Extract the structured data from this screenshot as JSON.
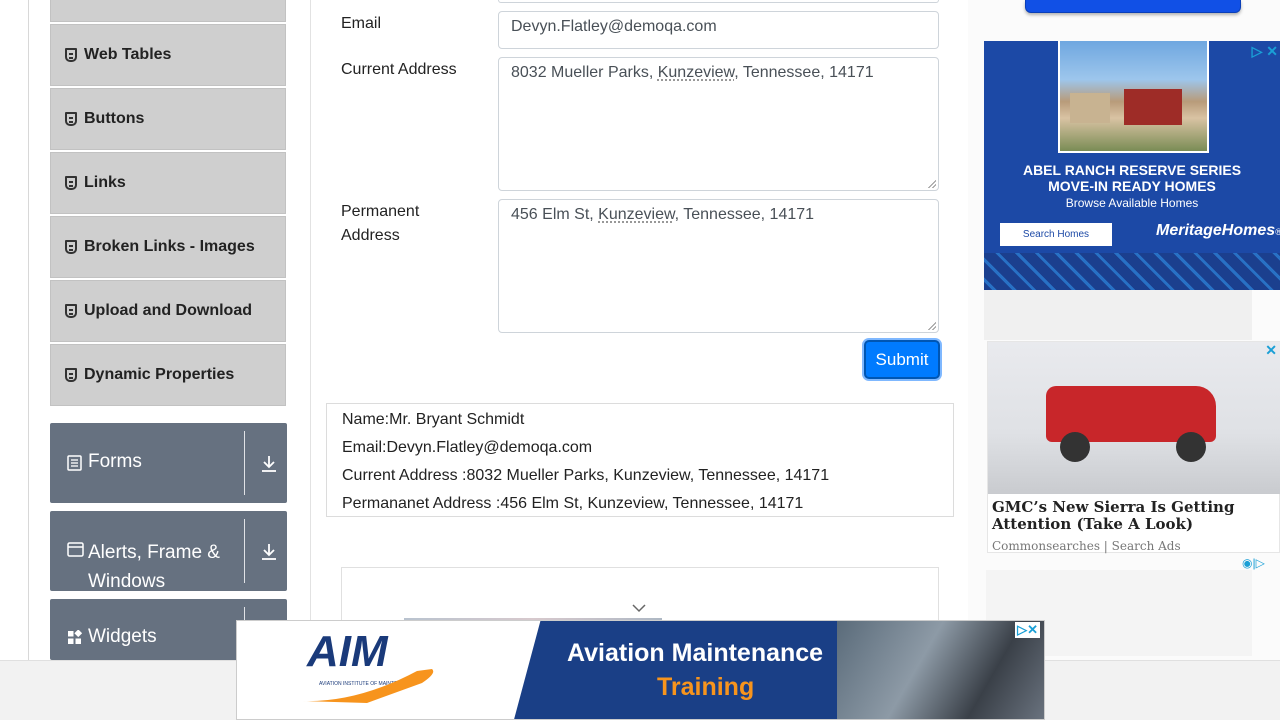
{
  "sidebar": {
    "elements_items": [
      {
        "label": "Web Tables"
      },
      {
        "label": "Buttons"
      },
      {
        "label": "Links"
      },
      {
        "label": "Broken Links - Images"
      },
      {
        "label": "Upload and Download"
      },
      {
        "label": "Dynamic Properties"
      }
    ],
    "groups": [
      {
        "label": "Forms"
      },
      {
        "label": "Alerts, Frame & Windows"
      },
      {
        "label": "Widgets"
      }
    ]
  },
  "form": {
    "email_label": "Email",
    "email_value": "Devyn.Flatley@demoqa.com",
    "current_address_label": "Current Address",
    "current_address": {
      "part1": "8032 Mueller Parks, ",
      "city": "Kunzeview",
      "part2": ", Tennessee, 14171"
    },
    "permanent_address_label_line1": "Permanent",
    "permanent_address_label_line2": "Address",
    "permanent_address": {
      "part1": "456 Elm St, ",
      "city": "Kunzeview",
      "part2": ", Tennessee, 14171"
    },
    "submit_label": "Submit"
  },
  "output": {
    "name": "Name:Mr. Bryant Schmidt",
    "email": "Email:Devyn.Flatley@demoqa.com",
    "current_address": "Current Address :8032 Mueller Parks, Kunzeview, Tennessee, 14171",
    "permanent_address": "Permananet Address :456 Elm St, Kunzeview, Tennessee, 14171"
  },
  "ads": {
    "home_ad": {
      "headline_line1": "ABEL RANCH RESERVE SERIES",
      "headline_line2": "MOVE-IN READY HOMES",
      "subline": "Browse Available Homes",
      "button": "Search Homes",
      "brand": "MeritageHomes",
      "brand_suffix": "®"
    },
    "truck_ad": {
      "title_line1": "GMC’s New Sierra Is Getting",
      "title_line2": "Attention (Take A Look)",
      "source": "Commonsearches | Search Ads"
    },
    "bottom_ad": {
      "brand": "AIM",
      "brand_small": "AVIATION INSTITUTE OF MAINTENANCE",
      "line1": "Aviation Maintenance",
      "line2": "Training"
    }
  },
  "colors": {
    "primary": "#007bff",
    "group_bg": "#667180",
    "item_bg": "#cfcfcf",
    "training_orange": "#f7941d",
    "ad_navy": "#1a3a7a"
  }
}
